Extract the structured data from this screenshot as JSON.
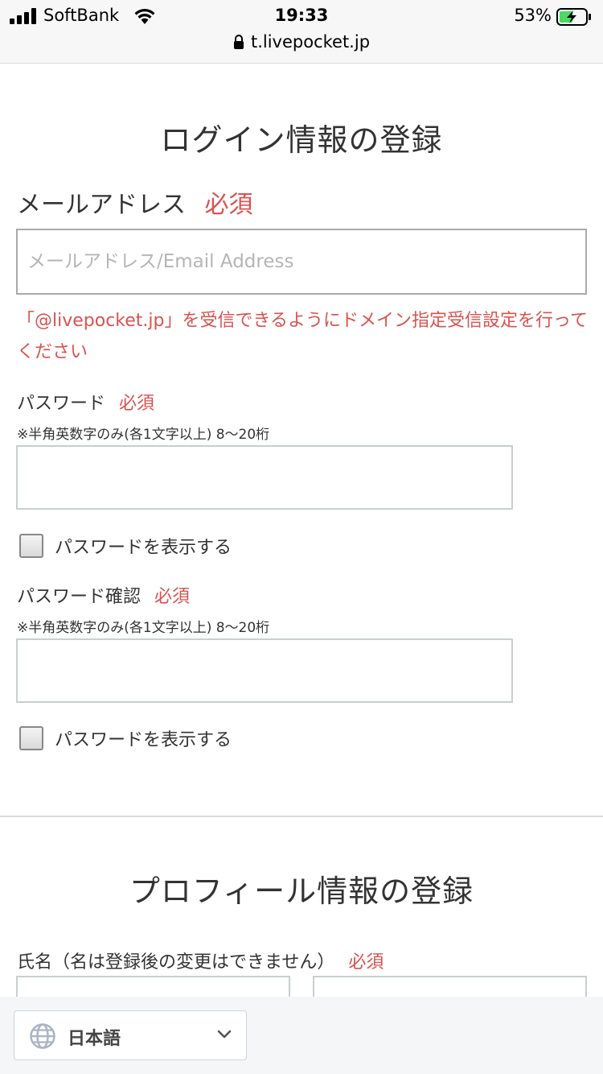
{
  "status_bar": {
    "carrier": "SoftBank",
    "time": "19:33",
    "battery": "53%",
    "battery_level": 0.53
  },
  "browser": {
    "url": "t.livepocket.jp"
  },
  "login_section": {
    "title": "ログイン情報の登録",
    "email": {
      "label": "メールアドレス",
      "required": "必須",
      "placeholder": "メールアドレス/Email Address",
      "value": ""
    },
    "domain_hint": "「@livepocket.jp」を受信できるようにドメイン指定受信設定を行ってください",
    "password": {
      "label": "パスワード",
      "required": "必須",
      "note": "※半角英数字のみ(各1文字以上) 8〜20桁",
      "value": "",
      "show_label": "パスワードを表示する"
    },
    "password_confirm": {
      "label": "パスワード確認",
      "required": "必須",
      "note": "※半角英数字のみ(各1文字以上) 8〜20桁",
      "value": "",
      "show_label": "パスワードを表示する"
    }
  },
  "profile_section": {
    "title": "プロフィール情報の登録",
    "name": {
      "label": "氏名（名は登録後の変更はできません）",
      "required": "必須",
      "last_value": "",
      "first_value": ""
    }
  },
  "language_selector": {
    "selected": "日本語",
    "icon": "globe-icon"
  },
  "colors": {
    "required_red": "#d9534f",
    "text": "#333333"
  }
}
